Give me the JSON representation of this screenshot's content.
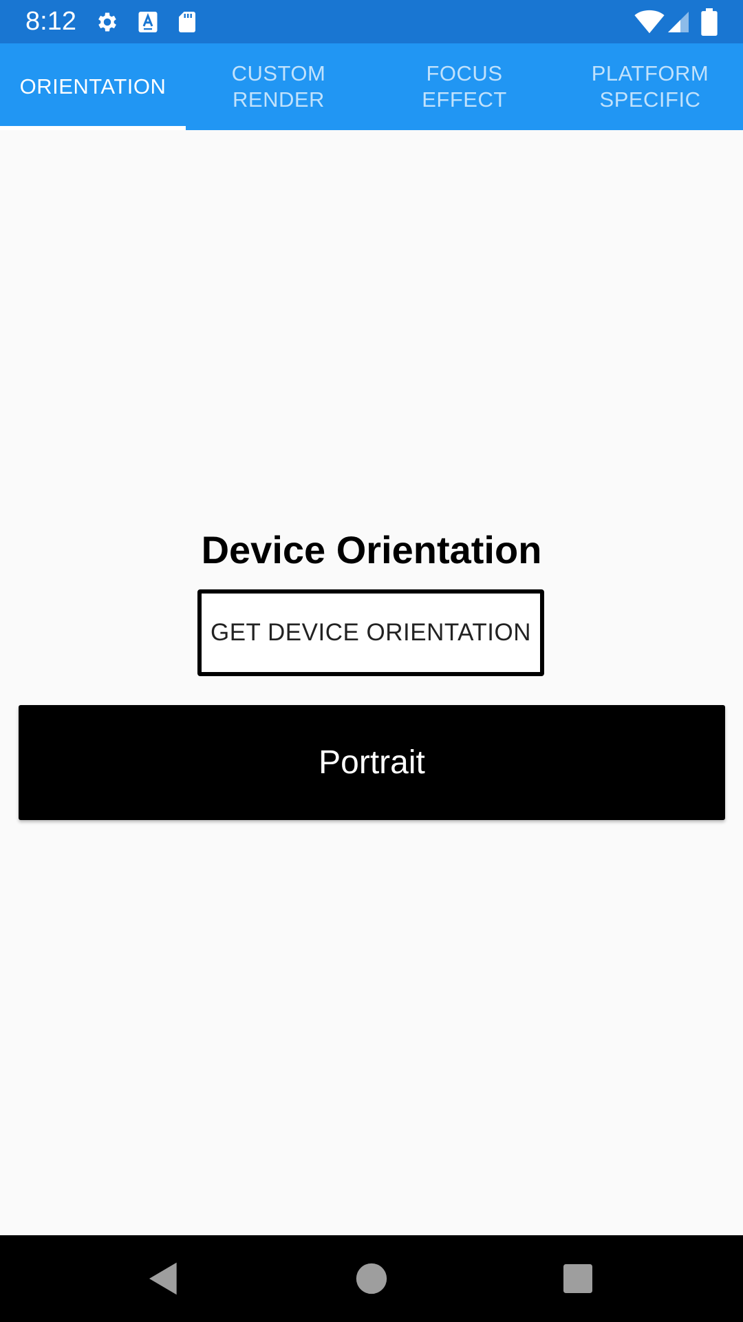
{
  "status_bar": {
    "time": "8:12",
    "left_icons": [
      "gear-icon",
      "text-a-icon",
      "sd-card-icon"
    ],
    "right_icons": [
      "wifi-icon",
      "cell-signal-icon",
      "battery-icon"
    ]
  },
  "tabs": [
    {
      "label": "ORIENTATION",
      "active": true
    },
    {
      "label": "CUSTOM\nRENDER",
      "active": false
    },
    {
      "label": "FOCUS\nEFFECT",
      "active": false
    },
    {
      "label": "PLATFORM\nSPECIFIC",
      "active": false
    }
  ],
  "main": {
    "title": "Device Orientation",
    "get_button_label": "GET DEVICE ORIENTATION",
    "result_value": "Portrait"
  },
  "nav_bar": {
    "buttons": [
      "back-icon",
      "home-icon",
      "recents-icon"
    ]
  },
  "colors": {
    "status_bar": "#1976d2",
    "tab_bar": "#2196f3",
    "background": "#fafafa",
    "result_bg": "#000000",
    "nav_bar": "#000000"
  }
}
